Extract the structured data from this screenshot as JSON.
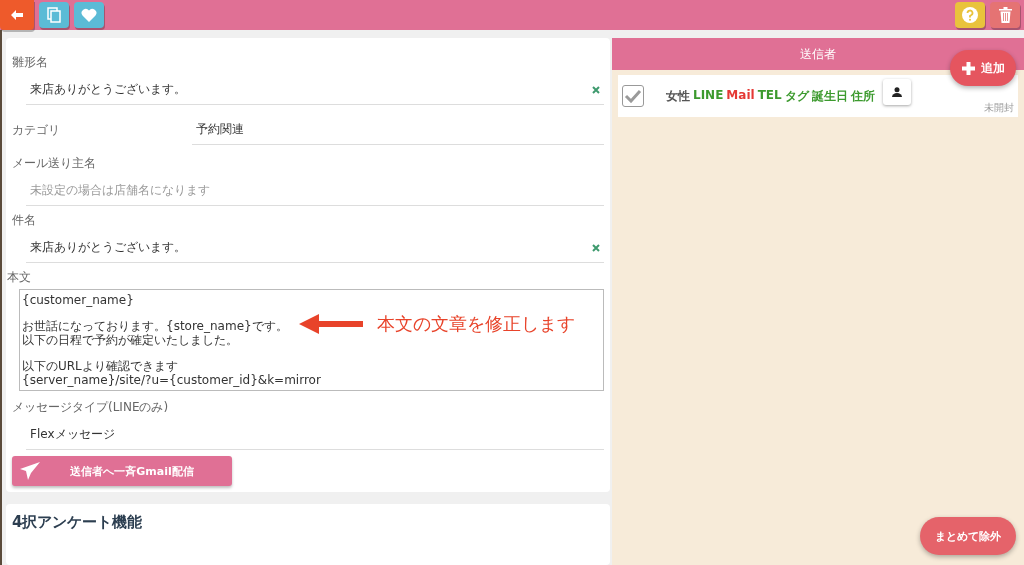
{
  "form": {
    "fields": [
      {
        "kind": "text",
        "label": "雛形名",
        "value": "来店ありがとうございます。",
        "clearable": true
      },
      {
        "kind": "inline",
        "label": "カテゴリ",
        "value": "予約関連",
        "clearable": false
      },
      {
        "kind": "text",
        "label": "メール送り主名",
        "placeholder": "未設定の場合は店舗名になります",
        "clearable": false
      },
      {
        "kind": "text",
        "label": "件名",
        "value": "来店ありがとうございます。",
        "clearable": true
      },
      {
        "kind": "textarea",
        "label": "本文",
        "lines": [
          "{customer_name}",
          "お世話になっております。{store_name}です。",
          "以下の日程で予約が確定いたしました。",
          "以下のURLより確認できます",
          "{server_name}/site/?u={customer_id}&k=mirror"
        ]
      },
      {
        "kind": "text",
        "label": "メッセージタイプ(LINEのみ)",
        "value": "Flexメッセージ",
        "clearable": false
      }
    ],
    "send_button": "送信者へ一斉Gmail配信",
    "annotation": "本文の文章を修正します"
  },
  "next_section": {
    "title": "4択アンケート機能"
  },
  "senders": {
    "title": "送信者",
    "add_button": "追加",
    "exclude_button": "まとめて除外",
    "rows": [
      {
        "checked": true,
        "tags": [
          {
            "label": "女性",
            "color": "#555555"
          },
          {
            "label": "LINE",
            "color": "#3c9a2e"
          },
          {
            "label": "Mail",
            "color": "#e53935"
          },
          {
            "label": "TEL",
            "color": "#3c9a2e"
          },
          {
            "label": "タグ",
            "color": "#3c9a2e"
          },
          {
            "label": "誕生日",
            "color": "#3c9a2e"
          },
          {
            "label": "住所",
            "color": "#3c9a2e"
          }
        ],
        "status": "未開封"
      }
    ]
  }
}
